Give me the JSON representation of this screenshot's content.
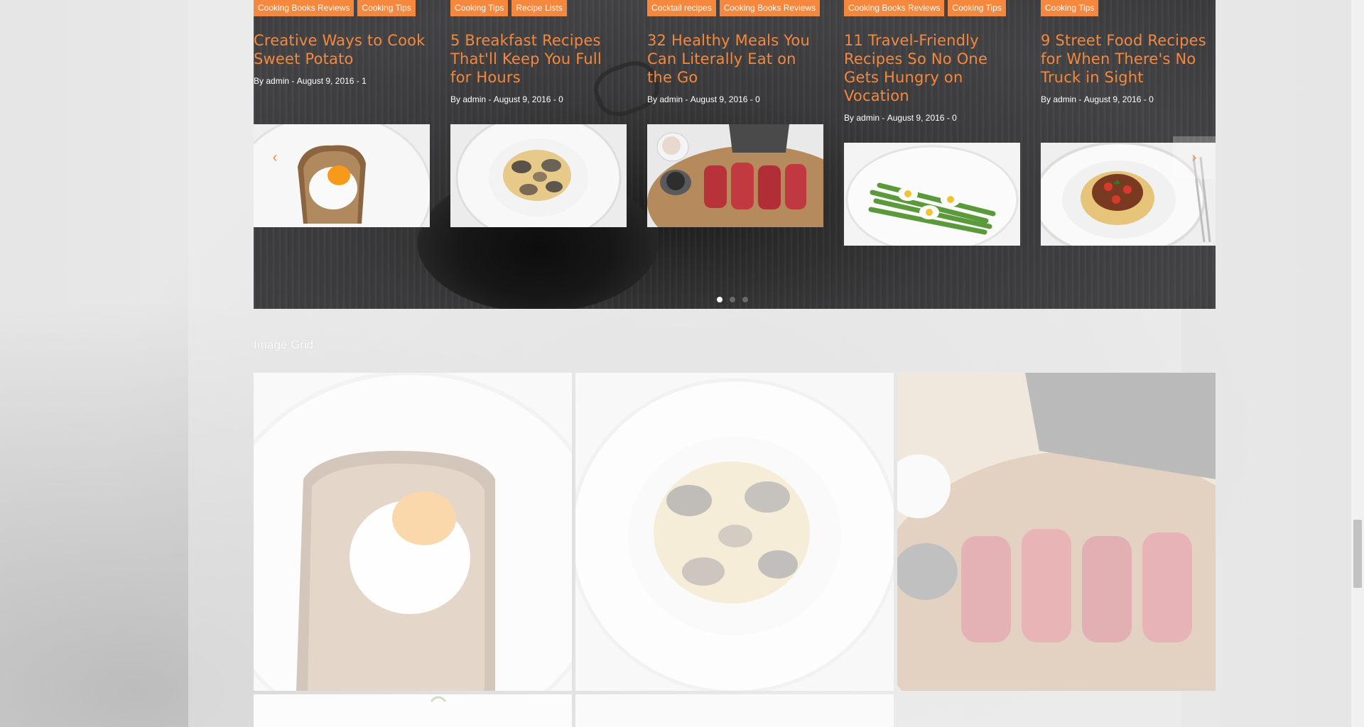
{
  "carousel": {
    "cards": [
      {
        "tags": [
          "Cooking Books Reviews",
          "Cooking Tips"
        ],
        "title": "Creative Ways to Cook Sweet Potato",
        "author_prefix": "By",
        "author": "admin",
        "date": "August 9, 2016",
        "comments": "1",
        "image_icon": "egg-toast-image"
      },
      {
        "tags": [
          "Cooking Tips",
          "Recipe Lists"
        ],
        "title": "5 Breakfast Recipes That'll Keep You Full for Hours",
        "author_prefix": "By",
        "author": "admin",
        "date": "August 9, 2016",
        "comments": "0",
        "image_icon": "clam-pasta-image"
      },
      {
        "tags": [
          "Cocktail recipes",
          "Cooking Books Reviews"
        ],
        "title": "32 Healthy Meals You Can Literally Eat on the Go",
        "author_prefix": "By",
        "author": "admin",
        "date": "August 9, 2016",
        "comments": "0",
        "image_icon": "lamb-chops-image"
      },
      {
        "tags": [
          "Cooking Books Reviews",
          "Cooking Tips"
        ],
        "title": "11 Travel-Friendly Recipes So No One Gets Hungry on Vocation",
        "author_prefix": "By",
        "author": "admin",
        "date": "August 9, 2016",
        "comments": "0",
        "image_icon": "asparagus-egg-image"
      },
      {
        "tags": [
          "Cooking Tips"
        ],
        "title": "9 Street Food Recipes for When There's No Truck in Sight",
        "author_prefix": "By",
        "author": "admin",
        "date": "August 9, 2016",
        "comments": "0",
        "image_icon": "spaghetti-bolognese-image"
      }
    ],
    "prev_icon": "‹",
    "next_icon": "›",
    "active_page": 1,
    "page_count": 3
  },
  "image_grid": {
    "title": "Image Grid"
  },
  "colors": {
    "accent": "#f5883d",
    "carousel_bg": "#3b3b3d"
  }
}
